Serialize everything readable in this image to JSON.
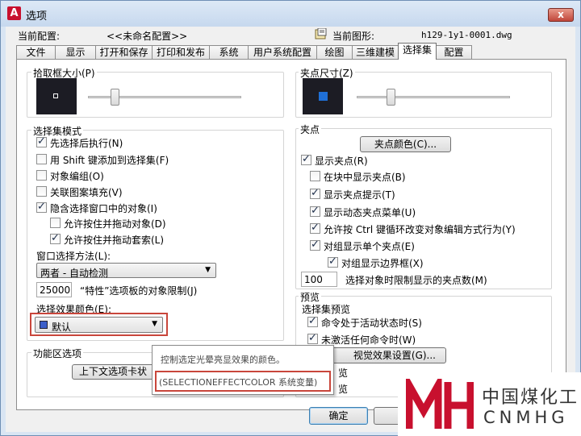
{
  "window": {
    "title": "选项",
    "close_label": "x"
  },
  "header": {
    "current_profile_label": "当前配置:",
    "current_profile_value": "<<未命名配置>>",
    "current_drawing_label": "当前图形:",
    "current_drawing_value": "h129-1y1-0001.dwg"
  },
  "tabs": [
    "文件",
    "显示",
    "打开和保存",
    "打印和发布",
    "系统",
    "用户系统配置",
    "绘图",
    "三维建模",
    "选择集",
    "配置"
  ],
  "active_tab": "选择集",
  "pickbox": {
    "title": "拾取框大小(P)",
    "level": 0.25
  },
  "grip_size": {
    "title": "夹点尺寸(Z)",
    "level": 0.23
  },
  "selection_modes": {
    "title": "选择集模式",
    "items": [
      {
        "label": "先选择后执行(N)",
        "checked": true
      },
      {
        "label": "用 Shift 键添加到选择集(F)",
        "checked": false
      },
      {
        "label": "对象编组(O)",
        "checked": false
      },
      {
        "label": "关联图案填充(V)",
        "checked": false
      },
      {
        "label": "隐含选择窗口中的对象(I)",
        "checked": true
      },
      {
        "label": "允许按住并拖动对象(D)",
        "checked": false
      },
      {
        "label": "允许按住并拖动套索(L)",
        "checked": true
      }
    ],
    "window_method_label": "窗口选择方法(L):",
    "window_method_value": "两者 - 自动检测",
    "limit_value": "25000",
    "limit_label": "“特性”选项板的对象限制(J)",
    "effect_color_label": "选择效果颜色(E):",
    "effect_color_value": "默认",
    "effect_color_swatch": "#3b5ec9"
  },
  "ribbon_options": {
    "title": "功能区选项",
    "button_label": "上下文选项卡状"
  },
  "grips": {
    "title": "夹点",
    "color_button": "夹点颜色(C)...",
    "items": [
      {
        "label": "显示夹点(R)",
        "checked": true
      },
      {
        "label": "在块中显示夹点(B)",
        "checked": false
      },
      {
        "label": "显示夹点提示(T)",
        "checked": true
      },
      {
        "label": "显示动态夹点菜单(U)",
        "checked": true
      },
      {
        "label": "允许按 Ctrl 键循环改变对象编辑方式行为(Y)",
        "checked": true
      },
      {
        "label": "对组显示单个夹点(E)",
        "checked": true
      },
      {
        "label": "对组显示边界框(X)",
        "checked": true
      }
    ],
    "limit_value": "100",
    "limit_label": "选择对象时限制显示的夹点数(M)"
  },
  "preview": {
    "title": "预览",
    "subtitle": "选择集预览",
    "items": [
      {
        "label": "命令处于活动状态时(S)",
        "checked": true
      },
      {
        "label": "未激活任何命令时(W)",
        "checked": true
      }
    ],
    "visual_effects_button": "视觉效果设置(G)...",
    "hidden_line1": "览",
    "hidden_line2": "览"
  },
  "buttons": {
    "ok": "确定",
    "cancel": "取"
  },
  "tooltip": {
    "line1": "控制选定光晕亮显效果的颜色。",
    "line2": "(SELECTIONEFFECTCOLOR 系统变量)"
  },
  "watermark": {
    "cn": "中国煤化工",
    "en": "CNMHG",
    "logo_color": "#c8102e"
  },
  "colors": {
    "highlight": "#c9463b",
    "grip_blue": "#1f6fd6"
  }
}
